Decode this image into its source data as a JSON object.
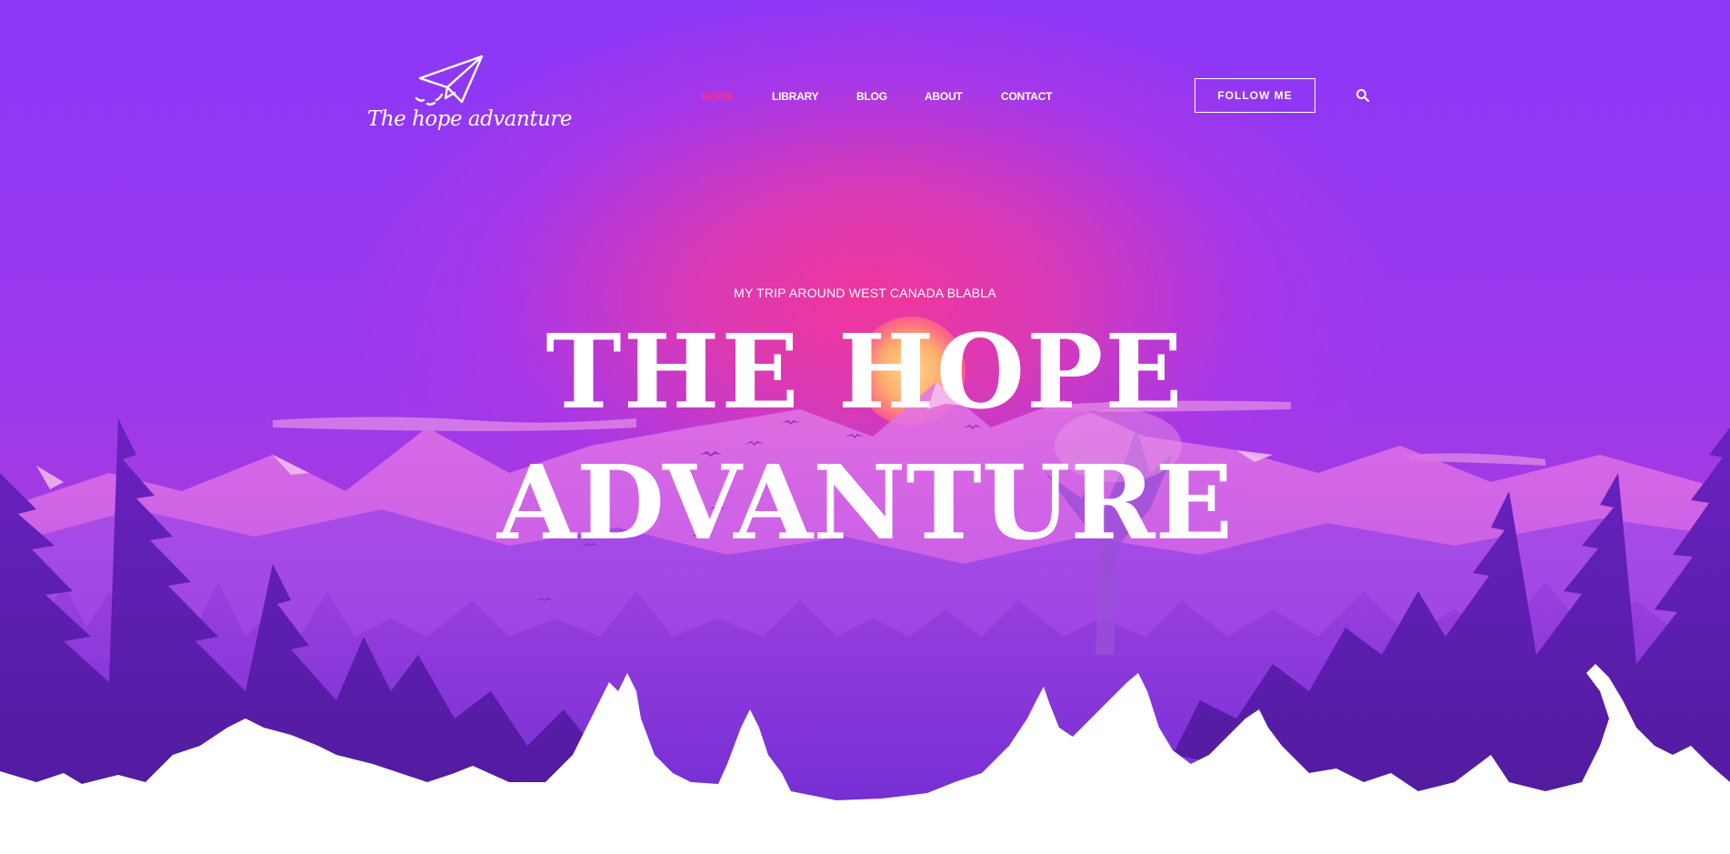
{
  "brand": {
    "name": "The hope advanture",
    "logo_icon": "paper-plane-icon"
  },
  "nav": {
    "items": [
      {
        "label": "HOME",
        "active": true
      },
      {
        "label": "LIBRARY",
        "active": false
      },
      {
        "label": "BLOG",
        "active": false
      },
      {
        "label": "ABOUT",
        "active": false
      },
      {
        "label": "CONTACT",
        "active": false
      }
    ],
    "follow_label": "FOLLOW ME",
    "search_icon": "search-icon"
  },
  "hero": {
    "subtitle": "MY TRIP AROUND WEST CANADA BLABLA",
    "title_line1": "THE HOPE",
    "title_line2": "ADVANTURE"
  },
  "colors": {
    "accent": "#ff2f7d",
    "sky_top": "#8b37f6",
    "sky_glow": "#f0369c",
    "text": "#ffffff"
  }
}
